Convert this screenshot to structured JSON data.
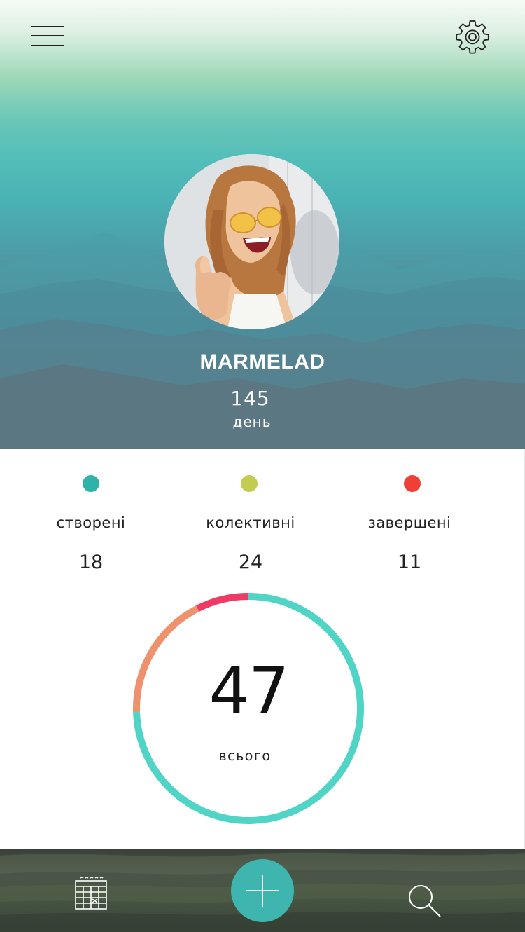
{
  "header": {
    "menu_icon": "hamburger-menu-icon",
    "settings_icon": "gear-icon",
    "avatar_alt": "profile-photo"
  },
  "profile": {
    "username": "MARMELAD",
    "day_count": "145",
    "day_label": "день"
  },
  "stats": [
    {
      "label": "створені",
      "value": "18",
      "color": "#2fb2a7"
    },
    {
      "label": "колективні",
      "value": "24",
      "color": "#c3cc4f"
    },
    {
      "label": "завершені",
      "value": "11",
      "color": "#ee4036"
    }
  ],
  "total": {
    "value": "47",
    "label": "всього"
  },
  "chart_data": {
    "type": "pie",
    "categories": [
      "створені",
      "колективні",
      "завершені"
    ],
    "values": [
      18,
      24,
      11
    ],
    "colors": [
      "#4fd4c6",
      "#f0916e",
      "#f03a66"
    ],
    "title": "",
    "total": 47
  },
  "bottom_nav": {
    "calendar_icon": "calendar-icon",
    "add_icon": "plus-icon",
    "search_icon": "search-icon",
    "accent": "#3eb5ae"
  }
}
